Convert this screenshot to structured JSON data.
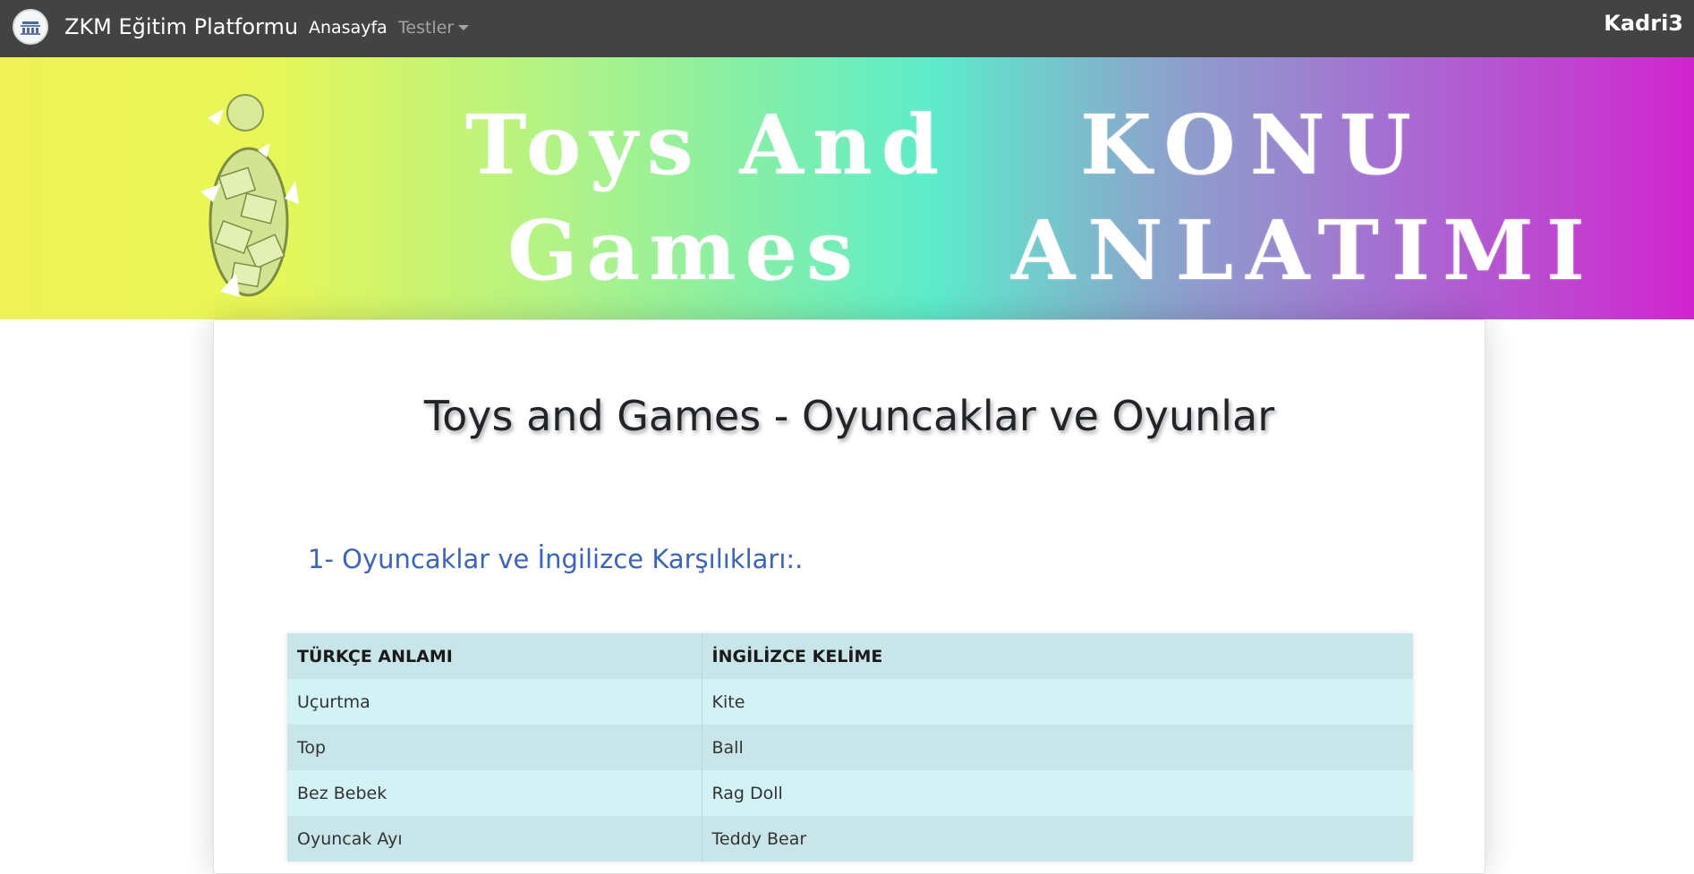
{
  "navbar": {
    "brand": "ZKM Eğitim Platformu",
    "home": "Anasayfa",
    "tests": "Testler",
    "user": "Kadri3"
  },
  "banner": {
    "line1": "Toys And",
    "line2": "Games",
    "line3": "KONU",
    "line4": "ANLATIMI"
  },
  "main": {
    "title": "Toys and Games - Oyuncaklar ve Oyunlar",
    "section_heading": "1- Oyuncaklar ve İngilizce Karşılıkları:.",
    "table": {
      "headers": [
        "TÜRKÇE ANLAMI",
        "İNGİLİZCE KELİME"
      ],
      "rows": [
        [
          "Uçurtma",
          "Kite"
        ],
        [
          "Top",
          "Ball"
        ],
        [
          "Bez Bebek",
          "Rag Doll"
        ],
        [
          "Oyuncak Ayı",
          "Teddy Bear"
        ]
      ]
    }
  },
  "colors": {
    "navbar_bg": "#434343",
    "heading_blue": "#3a63c8",
    "table_row_light": "#d2f2f5",
    "table_row_dark": "#c8e6ea"
  }
}
